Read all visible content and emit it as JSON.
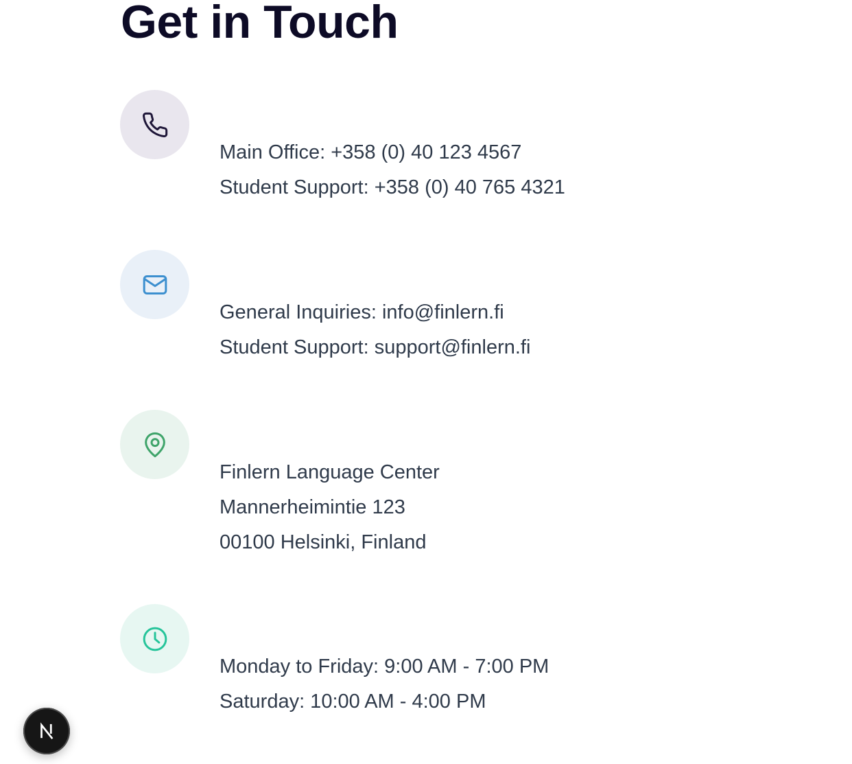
{
  "page": {
    "title": "Get in Touch"
  },
  "contacts": [
    {
      "icon": "phone-icon",
      "accent": "#1e1638",
      "lines": [
        "Main Office: +358 (0) 40 123 4567",
        "Student Support: +358 (0) 40 765 4321"
      ]
    },
    {
      "icon": "mail-icon",
      "accent": "#3c8fcf",
      "lines": [
        "General Inquiries: info@finlern.fi",
        "Student Support: support@finlern.fi"
      ]
    },
    {
      "icon": "map-pin-icon",
      "accent": "#3fa46a",
      "lines": [
        "Finlern Language Center",
        "Mannerheimintie 123",
        "00100 Helsinki, Finland"
      ]
    },
    {
      "icon": "clock-icon",
      "accent": "#26c49a",
      "lines": [
        "Monday to Friday: 9:00 AM - 7:00 PM",
        "Saturday: 10:00 AM - 4:00 PM"
      ]
    }
  ],
  "dev_badge": {
    "icon": "nextjs-logo-icon",
    "label": "N"
  }
}
